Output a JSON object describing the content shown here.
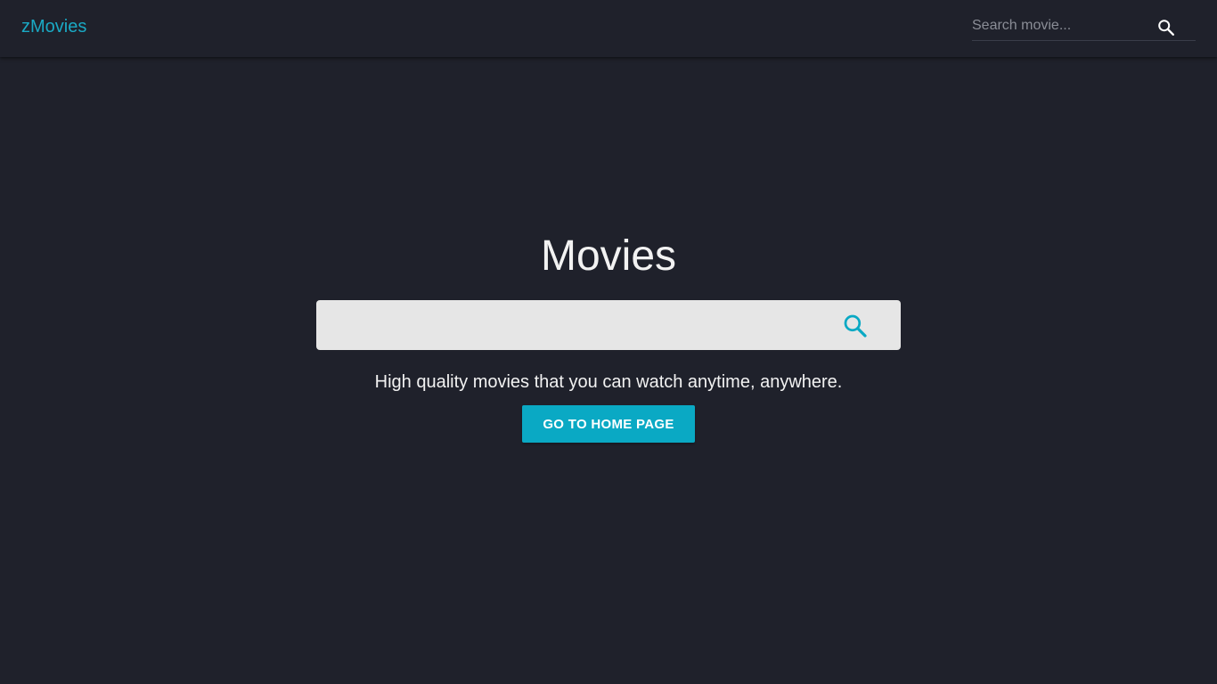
{
  "navbar": {
    "brand": "zMovies",
    "search_placeholder": "Search movie...",
    "search_value": "",
    "search_icon": "search-icon"
  },
  "hero": {
    "title": "Movies",
    "search_value": "",
    "search_icon": "search-icon",
    "tagline": "High quality movies that you can watch anytime, anywhere.",
    "home_button_label": "GO TO HOME PAGE"
  },
  "colors": {
    "background": "#1f212b",
    "accent": "#0aa9c4",
    "text": "#f2f2f2",
    "search_box": "#e6e6e6"
  }
}
